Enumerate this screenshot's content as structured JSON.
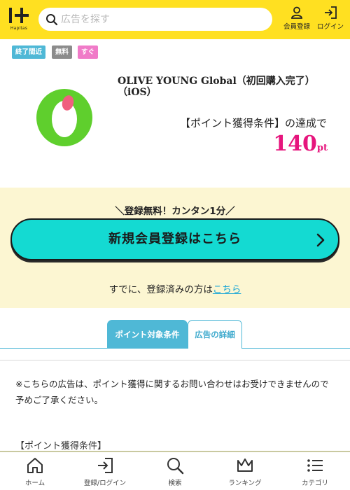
{
  "header": {
    "logo_text": "Hapitas",
    "search_placeholder": "広告を探す",
    "register_label": "会員登録",
    "login_label": "ログイン",
    "bg_color": "#ffe021"
  },
  "tags": [
    {
      "label": "終了間近",
      "color": "#4fb8d6"
    },
    {
      "label": "無料",
      "color": "#8c8c8c"
    },
    {
      "label": "すぐ",
      "color": "#f07bc8"
    }
  ],
  "ad": {
    "logo_icon": "olive-young-logo-icon",
    "title": "OLIVE YOUNG Global（初回購入完了）（iOS）",
    "condition": "【ポイント獲得条件】の達成で",
    "points": "140",
    "points_unit": "pt",
    "points_color": "#e6157d"
  },
  "registration": {
    "note": "＼登録無料！カンタン1分／",
    "button_label": "新規会員登録はこちら",
    "button_color": "#14dad2",
    "already_text": "すでに、登録済みの方は",
    "already_link": "こちら"
  },
  "tabs": [
    {
      "label": "ポイント対象条件",
      "active": true
    },
    {
      "label": "広告の詳細",
      "active": false
    }
  ],
  "content": {
    "notice": "※こちらの広告は、ポイント獲得に関するお問い合わせはお受けできませんので予めご了承ください。",
    "condition_heading": "【ポイント獲得条件】"
  },
  "bottom_nav": [
    {
      "label": "ホーム",
      "icon": "home-icon"
    },
    {
      "label": "登録/ログイン",
      "icon": "login-icon"
    },
    {
      "label": "検索",
      "icon": "search-icon"
    },
    {
      "label": "ランキング",
      "icon": "crown-icon"
    },
    {
      "label": "カテゴリ",
      "icon": "list-icon"
    }
  ]
}
